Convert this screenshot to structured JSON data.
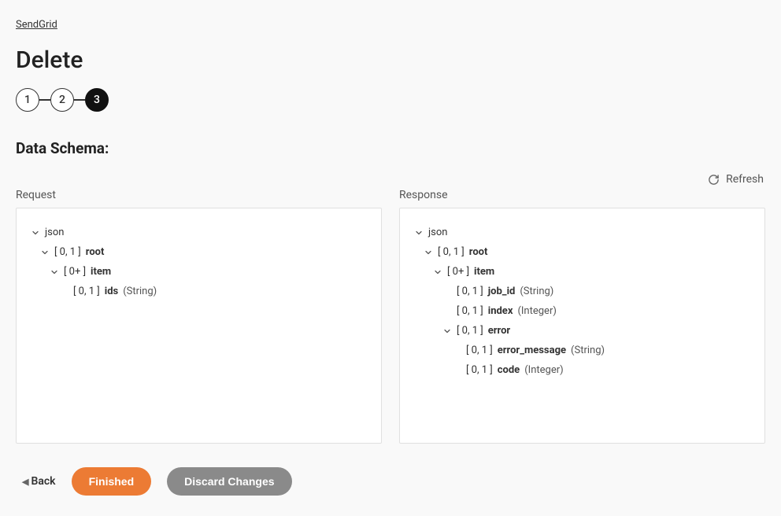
{
  "breadcrumb": {
    "link": "SendGrid"
  },
  "page": {
    "title": "Delete",
    "section": "Data Schema:"
  },
  "stepper": {
    "steps": [
      "1",
      "2",
      "3"
    ],
    "active_index": 2
  },
  "refresh": {
    "label": "Refresh"
  },
  "panels": {
    "request": {
      "label": "Request",
      "tree": [
        {
          "indent": 0,
          "chevron": true,
          "open": true,
          "text": "json"
        },
        {
          "indent": 1,
          "chevron": true,
          "open": true,
          "card": "[ 0, 1 ]",
          "name": "root"
        },
        {
          "indent": 2,
          "chevron": true,
          "open": true,
          "card": "[ 0+ ]",
          "name": "item"
        },
        {
          "indent": 3,
          "chevron": false,
          "card": "[ 0, 1 ]",
          "name": "ids",
          "type": "(String)"
        }
      ]
    },
    "response": {
      "label": "Response",
      "tree": [
        {
          "indent": 0,
          "chevron": true,
          "open": true,
          "text": "json"
        },
        {
          "indent": 1,
          "chevron": true,
          "open": true,
          "card": "[ 0, 1 ]",
          "name": "root"
        },
        {
          "indent": 2,
          "chevron": true,
          "open": true,
          "card": "[ 0+ ]",
          "name": "item"
        },
        {
          "indent": 3,
          "chevron": false,
          "card": "[ 0, 1 ]",
          "name": "job_id",
          "type": "(String)"
        },
        {
          "indent": 3,
          "chevron": false,
          "card": "[ 0, 1 ]",
          "name": "index",
          "type": "(Integer)"
        },
        {
          "indent": 3,
          "chevron": true,
          "open": true,
          "card": "[ 0, 1 ]",
          "name": "error"
        },
        {
          "indent": 4,
          "chevron": false,
          "card": "[ 0, 1 ]",
          "name": "error_message",
          "type": "(String)"
        },
        {
          "indent": 4,
          "chevron": false,
          "card": "[ 0, 1 ]",
          "name": "code",
          "type": "(Integer)"
        }
      ]
    }
  },
  "footer": {
    "back": "Back",
    "finished": "Finished",
    "discard": "Discard Changes"
  }
}
